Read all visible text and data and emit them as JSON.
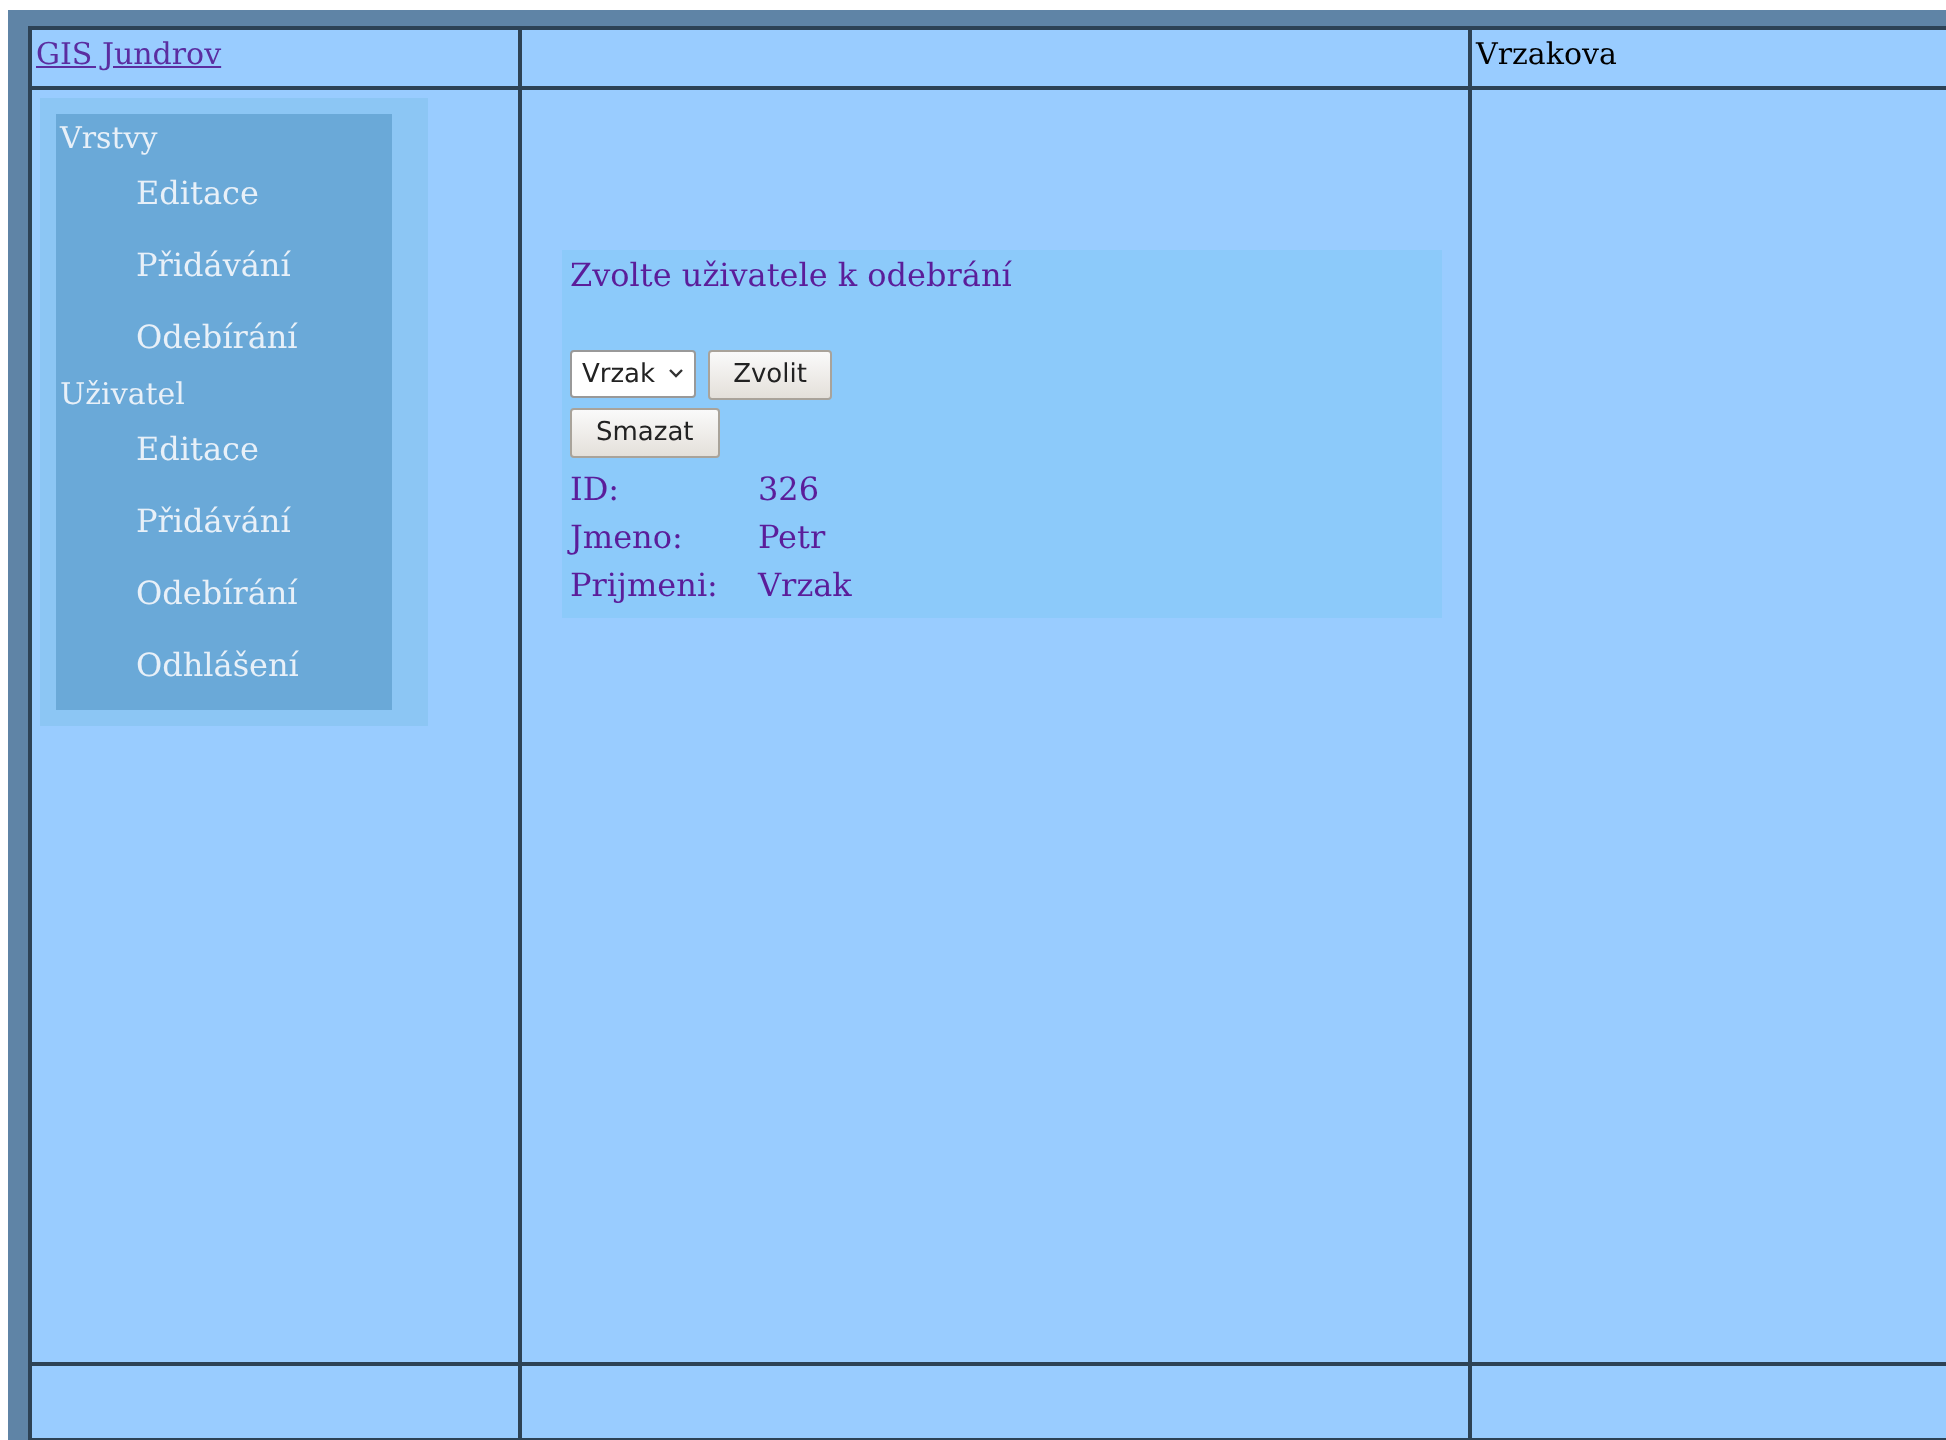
{
  "header": {
    "link": "GIS Jundrov",
    "right_text": "Vrzakova"
  },
  "menu": [
    {
      "label": "Vrstvy",
      "children": [
        {
          "label": "Editace"
        },
        {
          "label": "Přidávání"
        },
        {
          "label": "Odebírání"
        }
      ]
    },
    {
      "label": "Uživatel",
      "children": [
        {
          "label": "Editace"
        },
        {
          "label": "Přidávání"
        },
        {
          "label": "Odebírání"
        },
        {
          "label": "Odhlášení"
        }
      ]
    }
  ],
  "panel": {
    "title": "Zvolte uživatele k odebrání",
    "select_value": "Vrzak",
    "choose_button": "Zvolit",
    "delete_button": "Smazat",
    "fields": [
      {
        "label": "ID:",
        "value": "326"
      },
      {
        "label": "Jmeno:",
        "value": "Petr"
      },
      {
        "label": "Prijmeni:",
        "value": "Vrzak"
      }
    ]
  }
}
